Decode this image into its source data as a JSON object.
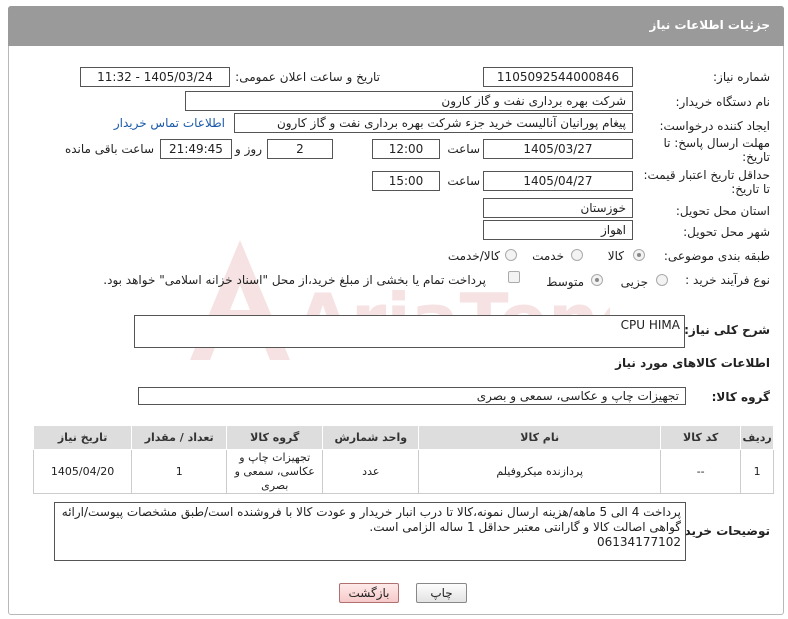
{
  "header": {
    "title": "جزئیات اطلاعات نیاز"
  },
  "form": {
    "need_number_label": "شماره نیاز:",
    "need_number": "1105092544000846",
    "announce_label": "تاریخ و ساعت اعلان عمومی:",
    "announce_value": "1405/03/24 - 11:32",
    "buyer_org_label": "نام دستگاه خریدار:",
    "buyer_org": "شرکت بهره برداری نفت و گاز کارون",
    "creator_label": "ایجاد کننده درخواست:",
    "creator": "پیغام پورانیان آنالیست خرید جزء شرکت بهره برداری نفت و گاز کارون",
    "contact_link": "اطلاعات تماس خریدار",
    "deadline_label_1": "مهلت ارسال پاسخ: تا",
    "deadline_label_2": "تاریخ:",
    "deadline_date": "1405/03/27",
    "time_label": "ساعت",
    "deadline_time": "12:00",
    "days": "2",
    "days_label": "روز و",
    "remaining": "21:49:45",
    "remaining_label": "ساعت باقی مانده",
    "price_label_1": "حداقل تاریخ اعتبار قیمت:",
    "price_label_2": "تا تاریخ:",
    "price_date": "1405/04/27",
    "price_time": "15:00",
    "province_label": "استان محل تحویل:",
    "province": "خوزستان",
    "city_label": "شهر محل تحویل:",
    "city": "اهواز",
    "category_label": "طبقه بندی موضوعی:",
    "category_options": [
      "کالا",
      "خدمت",
      "کالا/خدمت"
    ],
    "process_label": "نوع فرآیند خرید :",
    "process_options": [
      "جزیی",
      "متوسط"
    ],
    "payment_note": "پرداخت تمام یا بخشی از مبلغ خرید،از محل \"اسناد خزانه اسلامی\" خواهد بود."
  },
  "description": {
    "label": "شرح کلی نیاز:",
    "value": "CPU HIMA"
  },
  "goods": {
    "section_title": "اطلاعات کالاهای مورد نیاز",
    "group_label": "گروه کالا:",
    "group_value": "تجهیزات چاپ و عکاسی، سمعی و بصری",
    "columns": [
      "ردیف",
      "کد کالا",
      "نام کالا",
      "واحد شمارش",
      "گروه کالا",
      "تعداد / مقدار",
      "تاریخ نیاز"
    ],
    "rows": [
      {
        "row": "1",
        "code": "--",
        "name": "پردازنده میکروفیلم",
        "unit": "عدد",
        "group": "تجهیزات چاپ و عکاسی، سمعی و بصری",
        "qty": "1",
        "date": "1405/04/20"
      }
    ]
  },
  "buyer_notes": {
    "label": "توضیحات خریدار:",
    "line1": "پرداخت 4 الی 5 ماهه/هزینه ارسال نمونه،کالا تا درب انبار خریدار و عودت کالا با فروشنده است/طبق مشخصات پیوست/ارائه",
    "line2": "گواهی اصالت کالا و گارانتی معتبر حداقل 1 ساله الزامی است.",
    "line3": "06134177102"
  },
  "buttons": {
    "print": "چاپ",
    "back": "بازگشت"
  },
  "watermark": "AriaTender.neT",
  "colors": {
    "titlebar": "#9a9a9a",
    "link": "#1a5aa8",
    "back_button": "#f6c9c9",
    "watermark": "#c0262d"
  }
}
